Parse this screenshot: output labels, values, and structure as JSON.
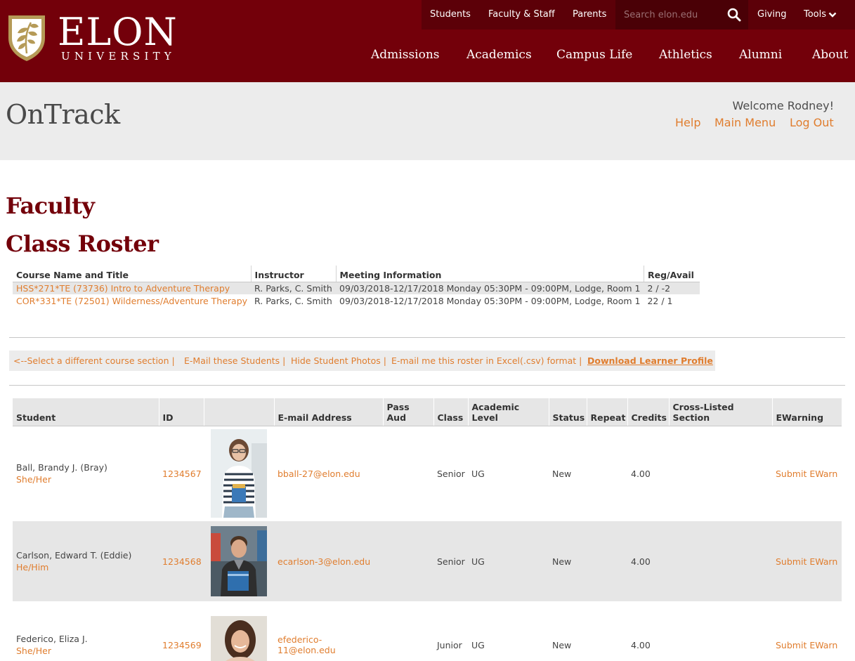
{
  "header": {
    "logo_main": "ELON",
    "logo_sub": "UNIVERSITY",
    "utility_links": [
      "Students",
      "Faculty & Staff",
      "Parents"
    ],
    "search_placeholder": "Search elon.edu",
    "giving_label": "Giving",
    "tools_label": "Tools",
    "main_nav": [
      "Admissions",
      "Academics",
      "Campus Life",
      "Athletics",
      "Alumni",
      "About"
    ]
  },
  "app": {
    "title": "OnTrack",
    "welcome": "Welcome Rodney!",
    "links": [
      "Help",
      "Main Menu",
      "Log Out"
    ]
  },
  "page": {
    "section_heading": "Faculty",
    "page_heading": "Class Roster"
  },
  "course_table": {
    "headers": [
      "Course Name and Title",
      "Instructor",
      "Meeting Information",
      "Reg/Avail"
    ],
    "rows": [
      {
        "course": "HSS*271*TE (73736) Intro to Adventure Therapy",
        "instructor": "R. Parks, C. Smith",
        "meeting": "09/03/2018-12/17/2018 Monday 05:30PM - 09:00PM, Lodge, Room 1",
        "reg_avail": "2 / -2"
      },
      {
        "course": "COR*331*TE (72501) Wilderness/Adventure Therapy",
        "instructor": "R. Parks, C. Smith",
        "meeting": "09/03/2018-12/17/2018 Monday 05:30PM - 09:00PM, Lodge, Room 1",
        "reg_avail": "22 / 1"
      }
    ]
  },
  "actions": {
    "select_section": "<--Select a different course section |",
    "email_students": "E-Mail these Students |",
    "hide_photos": "Hide Student Photos |",
    "email_roster": "E-mail me this roster in Excel(.csv) format |",
    "download_profile": "Download Learner Profile"
  },
  "roster": {
    "headers": {
      "student": "Student",
      "id": "ID",
      "photo": "",
      "email": "E-mail Address",
      "pass_aud": "Pass Aud",
      "class": "Class",
      "academic_level": "Academic Level",
      "status": "Status",
      "repeat": "Repeat",
      "credits": "Credits",
      "cross_listed": "Cross-Listed Section",
      "ewarning": "EWarning"
    },
    "rows": [
      {
        "name": "Ball, Brandy J. (Bray)",
        "pronouns": "She/Her",
        "id": "1234567",
        "email": "bball-27@elon.edu",
        "pass_aud": "",
        "class": "Senior",
        "level": "UG",
        "status": "New",
        "repeat": "",
        "credits": "4.00",
        "cross_listed": "",
        "ewarn": "Submit EWarn"
      },
      {
        "name": "Carlson, Edward T. (Eddie)",
        "pronouns": "He/Him",
        "id": "1234568",
        "email": "ecarlson-3@elon.edu",
        "pass_aud": "",
        "class": "Senior",
        "level": "UG",
        "status": "New",
        "repeat": "",
        "credits": "4.00",
        "cross_listed": "",
        "ewarn": "Submit EWarn"
      },
      {
        "name": "Federico, Eliza J.",
        "pronouns": "She/Her",
        "id": "1234569",
        "email": "efederico-11@elon.edu",
        "pass_aud": "",
        "class": "Junior",
        "level": "UG",
        "status": "New",
        "repeat": "",
        "credits": "4.00",
        "cross_listed": "",
        "ewarn": "Submit EWarn"
      }
    ]
  },
  "colors": {
    "brand_maroon": "#73000a",
    "util_bar": "#5c0008",
    "link_orange": "#e07d2e",
    "gold": "#b59a57",
    "band_gray": "#ececec",
    "row_gray": "#e6e6e6"
  }
}
